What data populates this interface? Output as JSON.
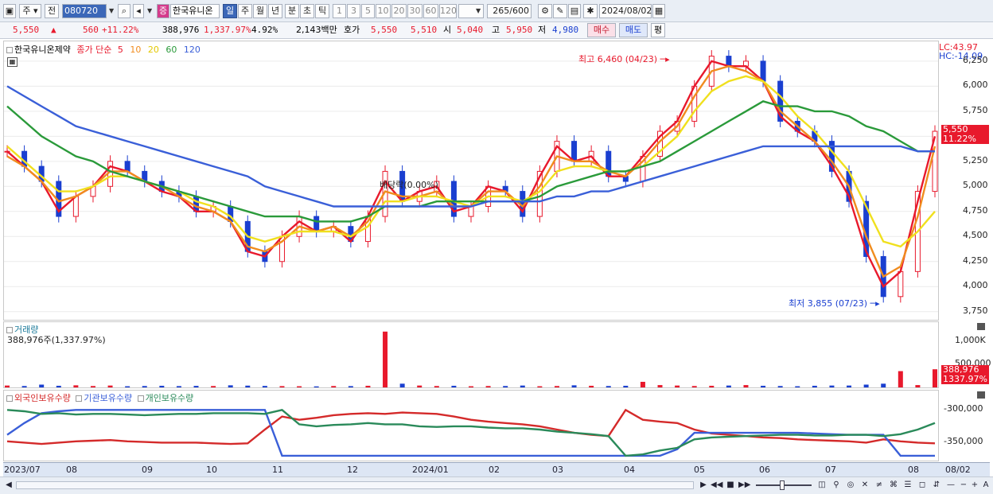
{
  "toolbar": {
    "market_label": "주",
    "prev_label": "전",
    "stock_code": "080720",
    "badge": "증",
    "stock_name": "한국유니온",
    "periods": [
      "일",
      "주",
      "월",
      "년",
      "분",
      "초",
      "틱"
    ],
    "active_period": "일",
    "intervals": [
      "1",
      "3",
      "5",
      "10",
      "20",
      "30",
      "60",
      "120"
    ],
    "count_current": "265",
    "count_total": "/600",
    "date": "2024/08/02"
  },
  "quote": {
    "price": "5,550",
    "change_arrow": "▲",
    "change": "560",
    "change_pct": "+11.22%",
    "volume": "388,976",
    "volume_pct": "1,337.97%",
    "turnover_pct": "4.92%",
    "amount": "2,143백만",
    "hoga_label": "호가",
    "ask": "5,550",
    "bid": "5,510",
    "open_label": "시",
    "open": "5,040",
    "high_label": "고",
    "high": "5,950",
    "low_label": "저",
    "low": "4,980",
    "sell_button": "매수",
    "buy_button": "매도",
    "avg_button": "평"
  },
  "price_pane": {
    "stock_name": "한국유니온제약",
    "ma_label": "종가 단순",
    "ma_periods": [
      "5",
      "10",
      "20",
      "60",
      "120"
    ],
    "ma_colors": [
      "#e8192c",
      "#f08c1e",
      "#f0e01e",
      "#2a9a3a",
      "#3a5fd8"
    ],
    "lc_label": "LC:43.97",
    "hc_label": "HC:-14.09",
    "price_ticks": [
      "6,250",
      "6,000",
      "5,750",
      "5,500",
      "5,250",
      "5,000",
      "4,750",
      "4,500",
      "4,250",
      "4,000",
      "3,750"
    ],
    "current_price_tag": "5,550",
    "current_pct_tag": "11.22%",
    "high_annotation": "최고 6,460 (04/23)",
    "low_annotation": "최저 3,855 (07/23)",
    "dividend_annotation": "배당락(0.00%)"
  },
  "volume_pane": {
    "title": "거래량",
    "value_label": "388,976주(1,337.97%)",
    "ticks": [
      "1,000K",
      "500,000"
    ],
    "current_tag": "388,976",
    "current_pct_tag": "1337.97%"
  },
  "holdings_pane": {
    "legend": [
      "외국인보유수량",
      "기관보유수량",
      "개인보유수량"
    ],
    "legend_colors": [
      "#d42a2a",
      "#3a5fd8",
      "#2a8a5a"
    ],
    "ticks": [
      "-300,000",
      "-350,000"
    ]
  },
  "xaxis": {
    "labels": [
      "2023/07",
      "08",
      "09",
      "10",
      "11",
      "12",
      "2024/01",
      "02",
      "03",
      "04",
      "05",
      "06",
      "07",
      "08"
    ],
    "right_label": "08/02"
  },
  "chart_data": {
    "type": "candlestick",
    "price_series_close": [
      5350,
      5200,
      5050,
      4700,
      4900,
      5000,
      5250,
      5150,
      5050,
      4950,
      4900,
      4750,
      4800,
      4650,
      4350,
      4250,
      4500,
      4700,
      4550,
      4600,
      4450,
      4700,
      5150,
      4850,
      4950,
      5050,
      4700,
      4800,
      5000,
      4950,
      4700,
      5150,
      5450,
      5250,
      5350,
      5100,
      5050,
      5300,
      5550,
      5650,
      6000,
      6300,
      6200,
      6250,
      6050,
      5650,
      5550,
      5450,
      5150,
      4850,
      4300,
      3900,
      4150,
      4950,
      5550
    ],
    "ma_series": [
      {
        "name": "5",
        "values": [
          5350,
          5200,
          5050,
          4750,
          4900,
          5000,
          5200,
          5150,
          5050,
          4950,
          4900,
          4750,
          4750,
          4650,
          4350,
          4300,
          4500,
          4650,
          4550,
          4600,
          4450,
          4700,
          5050,
          4850,
          4950,
          5000,
          4750,
          4800,
          5000,
          4950,
          4750,
          5100,
          5400,
          5250,
          5300,
          5100,
          5100,
          5300,
          5500,
          5650,
          6000,
          6250,
          6200,
          6200,
          6050,
          5700,
          5550,
          5450,
          5200,
          4900,
          4350,
          4000,
          4150,
          4850,
          5500
        ]
      },
      {
        "name": "10",
        "values": [
          5300,
          5200,
          5050,
          4850,
          4900,
          5000,
          5150,
          5150,
          5050,
          5000,
          4900,
          4800,
          4750,
          4650,
          4400,
          4350,
          4450,
          4600,
          4550,
          4600,
          4500,
          4650,
          4950,
          4900,
          4900,
          4950,
          4800,
          4800,
          4950,
          4950,
          4800,
          5000,
          5300,
          5250,
          5250,
          5150,
          5100,
          5250,
          5450,
          5600,
          5900,
          6150,
          6200,
          6150,
          6050,
          5750,
          5600,
          5450,
          5250,
          5000,
          4500,
          4100,
          4200,
          4700,
          5400
        ]
      },
      {
        "name": "20",
        "values": [
          5400,
          5250,
          5100,
          4950,
          4950,
          5000,
          5100,
          5100,
          5050,
          5000,
          4950,
          4850,
          4800,
          4700,
          4500,
          4450,
          4500,
          4550,
          4550,
          4550,
          4500,
          4600,
          4850,
          4850,
          4900,
          4900,
          4850,
          4800,
          4900,
          4900,
          4850,
          4950,
          5150,
          5200,
          5200,
          5150,
          5150,
          5200,
          5350,
          5500,
          5750,
          5950,
          6050,
          6100,
          6050,
          5900,
          5700,
          5550,
          5350,
          5150,
          4800,
          4450,
          4400,
          4550,
          4750
        ]
      },
      {
        "name": "60",
        "values": [
          5800,
          5650,
          5500,
          5400,
          5300,
          5250,
          5150,
          5100,
          5050,
          5000,
          4950,
          4900,
          4850,
          4800,
          4750,
          4700,
          4700,
          4700,
          4650,
          4650,
          4650,
          4700,
          4800,
          4800,
          4800,
          4850,
          4850,
          4850,
          4850,
          4850,
          4850,
          4900,
          5000,
          5050,
          5100,
          5150,
          5150,
          5200,
          5250,
          5350,
          5450,
          5550,
          5650,
          5750,
          5850,
          5800,
          5800,
          5750,
          5750,
          5700,
          5600,
          5550,
          5450,
          5350,
          5350
        ]
      },
      {
        "name": "120",
        "values": [
          6000,
          5900,
          5800,
          5700,
          5600,
          5550,
          5500,
          5450,
          5400,
          5350,
          5300,
          5250,
          5200,
          5150,
          5100,
          5000,
          4950,
          4900,
          4850,
          4800,
          4800,
          4800,
          4800,
          4800,
          4800,
          4800,
          4800,
          4800,
          4850,
          4850,
          4850,
          4850,
          4900,
          4900,
          4950,
          4950,
          5000,
          5050,
          5100,
          5150,
          5200,
          5250,
          5300,
          5350,
          5400,
          5400,
          5400,
          5400,
          5400,
          5400,
          5400,
          5400,
          5400,
          5350,
          5350
        ]
      }
    ],
    "y_range": [
      3700,
      6400
    ],
    "volume_series": [
      40,
      30,
      60,
      35,
      45,
      30,
      40,
      25,
      30,
      35,
      28,
      33,
      30,
      45,
      38,
      32,
      28,
      25,
      22,
      30,
      28,
      35,
      1200,
      80,
      40,
      30,
      35,
      25,
      30,
      30,
      40,
      25,
      30,
      45,
      35,
      30,
      35,
      120,
      50,
      40,
      30,
      35,
      40,
      50,
      35,
      30,
      25,
      35,
      40,
      40,
      60,
      80,
      350,
      50,
      390
    ],
    "volume_range": [
      0,
      1300
    ],
    "holdings_series": [
      {
        "name": "외국인보유수량",
        "values": [
          -348,
          -350,
          -352,
          -350,
          -348,
          -347,
          -346,
          -348,
          -349,
          -350,
          -350,
          -350,
          -351,
          -352,
          -351,
          -330,
          -310,
          -315,
          -312,
          -308,
          -306,
          -305,
          -306,
          -304,
          -305,
          -306,
          -310,
          -315,
          -318,
          -320,
          -322,
          -325,
          -330,
          -335,
          -338,
          -340,
          -300,
          -315,
          -318,
          -320,
          -330,
          -336,
          -338,
          -340,
          -342,
          -343,
          -345,
          -346,
          -347,
          -348,
          -350,
          -345,
          -348,
          -350,
          -351
        ]
      },
      {
        "name": "기관보유수량",
        "values": [
          -338,
          -320,
          -305,
          -302,
          -300,
          -300,
          -300,
          -300,
          -300,
          -300,
          -300,
          -300,
          -300,
          -300,
          -300,
          -300,
          -370,
          -370,
          -370,
          -370,
          -370,
          -370,
          -370,
          -370,
          -370,
          -370,
          -370,
          -370,
          -370,
          -370,
          -370,
          -370,
          -370,
          -370,
          -370,
          -370,
          -370,
          -370,
          -370,
          -360,
          -335,
          -335,
          -335,
          -335,
          -335,
          -335,
          -335,
          -336,
          -337,
          -338,
          -338,
          -338,
          -370,
          -370,
          -370
        ]
      },
      {
        "name": "개인보유수량",
        "values": [
          -300,
          -302,
          -306,
          -305,
          -307,
          -306,
          -306,
          -307,
          -308,
          -307,
          -306,
          -306,
          -305,
          -305,
          -305,
          -306,
          -300,
          -322,
          -325,
          -323,
          -322,
          -320,
          -322,
          -322,
          -325,
          -326,
          -325,
          -325,
          -327,
          -328,
          -328,
          -330,
          -333,
          -335,
          -337,
          -340,
          -370,
          -368,
          -362,
          -358,
          -345,
          -342,
          -341,
          -340,
          -339,
          -338,
          -338,
          -339,
          -339,
          -338,
          -338,
          -340,
          -337,
          -330,
          -320
        ]
      }
    ],
    "holdings_range": [
      -375,
      -285
    ]
  }
}
